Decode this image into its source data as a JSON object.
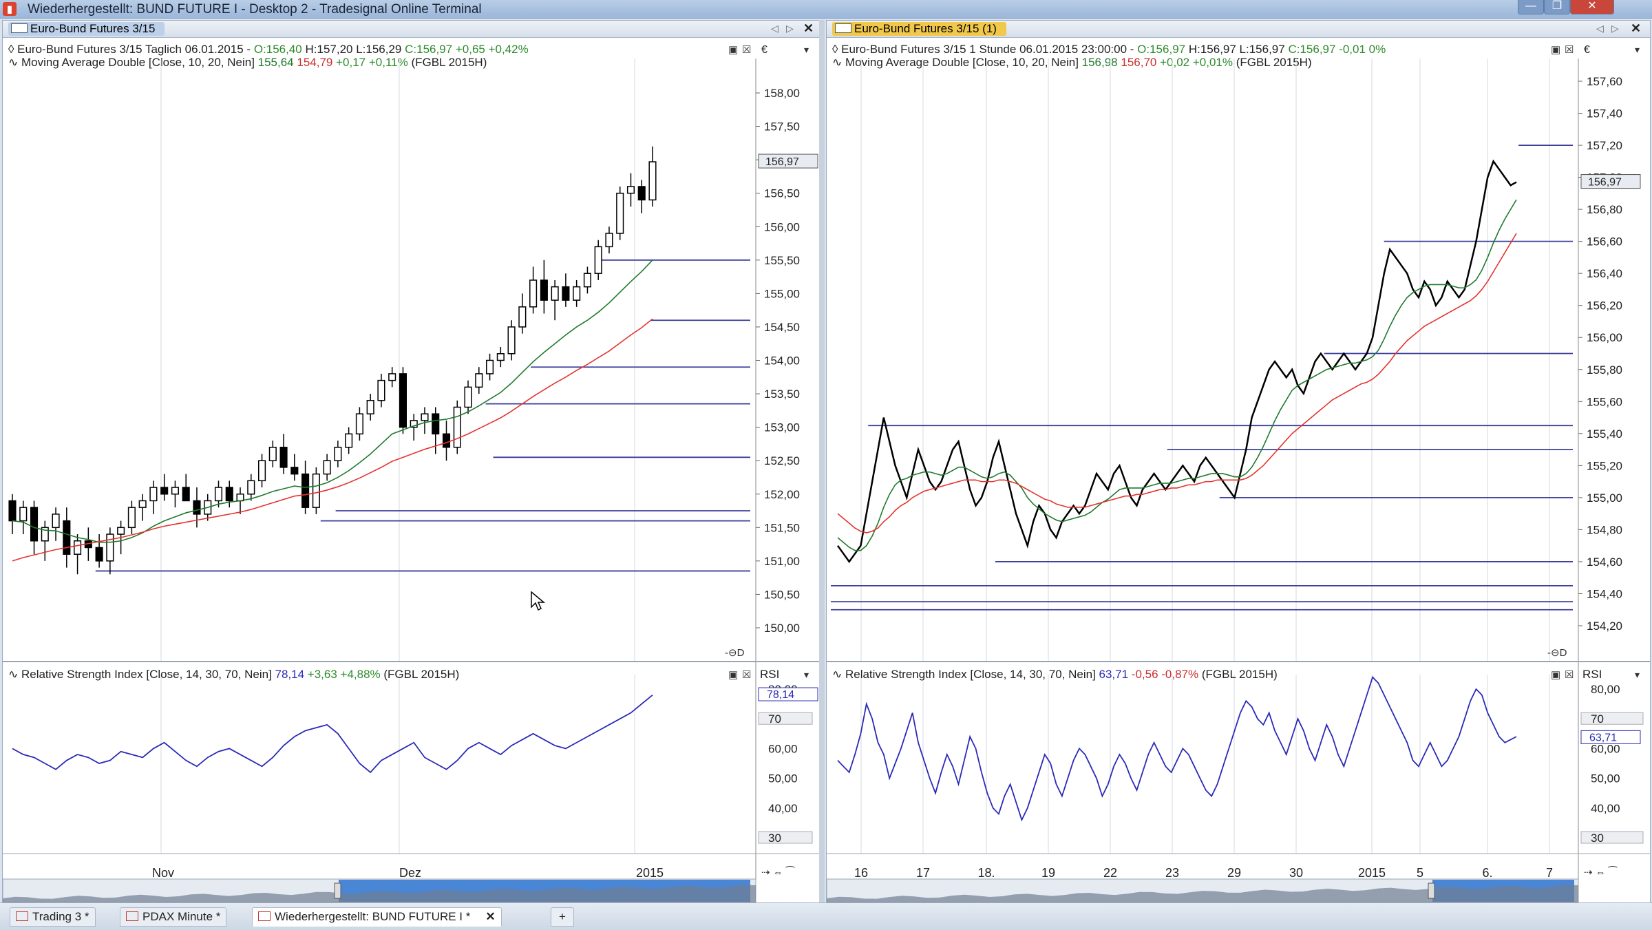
{
  "window": {
    "title": "Wiederhergestellt: BUND FUTURE I - Desktop 2 - Tradesignal Online Terminal",
    "minimize": "—",
    "maximize": "❐",
    "close": "✕"
  },
  "colors": {
    "accent": "#d9432f",
    "candle_up": "#ffffff",
    "candle_down": "#000000",
    "ma_short": "#1f7a2c",
    "ma_long": "#e3342f",
    "rsi": "#2a2ab8",
    "hline": "#3b3f9a",
    "price_tag": "#e8ecf2"
  },
  "left": {
    "tab_label": "Euro-Bund Futures 3/15",
    "header": {
      "line1_prefix": "Euro-Bund Futures 3/15 Taglich  06.01.2015 -",
      "line1_open": "O:156,40",
      "line1_hlc": "H:157,20 L:156,29",
      "line1_close": "C:156,97",
      "line1_change": "+0,65 +0,42%",
      "line2_prefix": "Moving Average Double [Close, 10, 20, Nein]",
      "line2_v1": "155,64",
      "line2_v2": "154,79",
      "line2_change": "+0,17 +0,11%",
      "line2_suffix": "(FGBL 2015H)"
    },
    "currency": "€",
    "price_tag": "156,97",
    "price_ticks": [
      "158,00",
      "157,50",
      "157,00",
      "156,50",
      "156,00",
      "155,50",
      "155,00",
      "154,50",
      "154,00",
      "153,50",
      "153,00",
      "152,50",
      "152,00",
      "151,50",
      "151,00",
      "150,50",
      "150,00"
    ],
    "rsi_header": {
      "prefix": "Relative Strength Index [Close, 14, 30, 70, Nein]",
      "value": "78,14",
      "change": "+3,63 +4,88%",
      "suffix": "(FGBL 2015H)"
    },
    "rsi_label": "RSI",
    "rsi_tag": "78,14",
    "rsi_ticks": [
      "80,00",
      "70",
      "60,00",
      "50,00",
      "40,00",
      "30"
    ],
    "x_labels": [
      "Nov",
      "Dez",
      "2015"
    ],
    "candles": [
      [
        151.9,
        152.0,
        151.4,
        151.6
      ],
      [
        151.6,
        151.9,
        151.4,
        151.8
      ],
      [
        151.8,
        151.9,
        151.1,
        151.3
      ],
      [
        151.3,
        151.6,
        151.0,
        151.5
      ],
      [
        151.5,
        151.8,
        151.3,
        151.7
      ],
      [
        151.6,
        151.8,
        150.9,
        151.1
      ],
      [
        151.1,
        151.4,
        150.8,
        151.3
      ],
      [
        151.3,
        151.5,
        151.0,
        151.2
      ],
      [
        151.2,
        151.4,
        150.9,
        151.0
      ],
      [
        151.0,
        151.5,
        150.8,
        151.4
      ],
      [
        151.4,
        151.6,
        151.1,
        151.5
      ],
      [
        151.5,
        151.9,
        151.4,
        151.8
      ],
      [
        151.8,
        152.0,
        151.6,
        151.9
      ],
      [
        151.9,
        152.2,
        151.7,
        152.1
      ],
      [
        152.1,
        152.3,
        151.9,
        152.0
      ],
      [
        152.0,
        152.2,
        151.8,
        152.1
      ],
      [
        152.1,
        152.3,
        151.9,
        151.9
      ],
      [
        151.9,
        152.1,
        151.5,
        151.7
      ],
      [
        151.7,
        152.0,
        151.6,
        151.9
      ],
      [
        151.9,
        152.2,
        151.8,
        152.1
      ],
      [
        152.1,
        152.2,
        151.8,
        151.9
      ],
      [
        151.9,
        152.1,
        151.7,
        152.0
      ],
      [
        152.0,
        152.3,
        151.9,
        152.2
      ],
      [
        152.2,
        152.6,
        152.1,
        152.5
      ],
      [
        152.5,
        152.8,
        152.4,
        152.7
      ],
      [
        152.7,
        152.9,
        152.3,
        152.4
      ],
      [
        152.4,
        152.6,
        152.2,
        152.3
      ],
      [
        152.3,
        152.5,
        151.7,
        151.8
      ],
      [
        151.8,
        152.4,
        151.7,
        152.3
      ],
      [
        152.3,
        152.6,
        152.2,
        152.5
      ],
      [
        152.5,
        152.8,
        152.4,
        152.7
      ],
      [
        152.7,
        153.0,
        152.6,
        152.9
      ],
      [
        152.9,
        153.3,
        152.8,
        153.2
      ],
      [
        153.2,
        153.5,
        153.1,
        153.4
      ],
      [
        153.4,
        153.8,
        153.3,
        153.7
      ],
      [
        153.7,
        153.9,
        153.6,
        153.8
      ],
      [
        153.8,
        153.9,
        152.9,
        153.0
      ],
      [
        153.0,
        153.2,
        152.8,
        153.1
      ],
      [
        153.1,
        153.3,
        152.9,
        153.2
      ],
      [
        153.2,
        153.3,
        152.6,
        152.9
      ],
      [
        152.9,
        153.1,
        152.5,
        152.7
      ],
      [
        152.7,
        153.4,
        152.6,
        153.3
      ],
      [
        153.3,
        153.7,
        153.2,
        153.6
      ],
      [
        153.6,
        153.9,
        153.5,
        153.8
      ],
      [
        153.8,
        154.1,
        153.7,
        154.0
      ],
      [
        154.0,
        154.2,
        153.9,
        154.1
      ],
      [
        154.1,
        154.6,
        154.0,
        154.5
      ],
      [
        154.5,
        155.0,
        154.4,
        154.8
      ],
      [
        154.8,
        155.4,
        154.7,
        155.2
      ],
      [
        155.2,
        155.5,
        154.7,
        154.9
      ],
      [
        154.9,
        155.2,
        154.6,
        155.1
      ],
      [
        155.1,
        155.3,
        154.8,
        154.9
      ],
      [
        154.9,
        155.2,
        154.8,
        155.1
      ],
      [
        155.1,
        155.4,
        155.0,
        155.3
      ],
      [
        155.3,
        155.8,
        155.2,
        155.7
      ],
      [
        155.7,
        156.0,
        155.6,
        155.9
      ],
      [
        155.9,
        156.6,
        155.8,
        156.5
      ],
      [
        156.5,
        156.8,
        156.3,
        156.6
      ],
      [
        156.6,
        156.7,
        156.2,
        156.4
      ],
      [
        156.4,
        157.2,
        156.3,
        156.97
      ]
    ],
    "ma10": [
      151.6,
      151.58,
      151.5,
      151.46,
      151.45,
      151.4,
      151.35,
      151.32,
      151.28,
      151.28,
      151.3,
      151.35,
      151.42,
      151.52,
      151.6,
      151.66,
      151.72,
      151.76,
      151.8,
      151.85,
      151.88,
      151.9,
      151.93,
      151.98,
      152.04,
      152.08,
      152.12,
      152.1,
      152.12,
      152.17,
      152.25,
      152.35,
      152.47,
      152.6,
      152.75,
      152.9,
      152.96,
      153.02,
      153.07,
      153.1,
      153.12,
      153.16,
      153.23,
      153.32,
      153.42,
      153.52,
      153.66,
      153.82,
      153.98,
      154.12,
      154.25,
      154.38,
      154.5,
      154.6,
      154.72,
      154.86,
      155.02,
      155.18,
      155.33,
      155.5
    ],
    "ma20": [
      151.0,
      151.05,
      151.09,
      151.13,
      151.17,
      151.2,
      151.23,
      151.26,
      151.29,
      151.32,
      151.35,
      151.39,
      151.43,
      151.48,
      151.52,
      151.55,
      151.58,
      151.61,
      151.64,
      151.67,
      151.7,
      151.73,
      151.77,
      151.82,
      151.87,
      151.92,
      151.97,
      151.99,
      152.02,
      152.06,
      152.11,
      152.17,
      152.24,
      152.32,
      152.4,
      152.49,
      152.55,
      152.61,
      152.67,
      152.72,
      152.77,
      152.83,
      152.9,
      152.98,
      153.06,
      153.14,
      153.24,
      153.35,
      153.46,
      153.56,
      153.66,
      153.75,
      153.85,
      153.94,
      154.04,
      154.14,
      154.26,
      154.38,
      154.49,
      154.62
    ],
    "hlines": [
      {
        "v": 155.5,
        "from": 0.79
      },
      {
        "v": 154.6,
        "from": 0.86
      },
      {
        "v": 153.9,
        "from": 0.7
      },
      {
        "v": 153.35,
        "from": 0.64
      },
      {
        "v": 152.55,
        "from": 0.65
      },
      {
        "v": 151.75,
        "from": 0.44
      },
      {
        "v": 151.6,
        "from": 0.42
      },
      {
        "v": 150.85,
        "from": 0.12
      }
    ],
    "rsi": [
      60,
      58,
      57,
      55,
      53,
      56,
      58,
      57,
      55,
      56,
      59,
      58,
      57,
      60,
      62,
      59,
      56,
      54,
      57,
      59,
      60,
      58,
      56,
      54,
      57,
      61,
      64,
      66,
      67,
      68,
      65,
      60,
      55,
      52,
      56,
      58,
      60,
      62,
      57,
      55,
      53,
      56,
      60,
      62,
      60,
      58,
      61,
      63,
      65,
      63,
      61,
      60,
      62,
      64,
      66,
      68,
      70,
      72,
      75,
      78
    ]
  },
  "right": {
    "tab_label": "Euro-Bund Futures 3/15 (1)",
    "header": {
      "line1_prefix": "Euro-Bund Futures 3/15 1 Stunde  06.01.2015 23:00:00 -",
      "line1_open": "O:156,97",
      "line1_hlc": "H:156,97 L:156,97",
      "line1_close": "C:156,97",
      "line1_change": "-0,01 0%",
      "line2_prefix": "Moving Average Double [Close, 10, 20, Nein]",
      "line2_v1": "156,98",
      "line2_v2": "156,70",
      "line2_change": "+0,02 +0,01%",
      "line2_suffix": "(FGBL 2015H)"
    },
    "currency": "€",
    "price_tag": "156,97",
    "price_ticks": [
      "157,60",
      "157,40",
      "157,20",
      "157,00",
      "156,80",
      "156,60",
      "156,40",
      "156,20",
      "156,00",
      "155,80",
      "155,60",
      "155,40",
      "155,20",
      "155,00",
      "154,80",
      "154,60",
      "154,40",
      "154,20"
    ],
    "rsi_header": {
      "prefix": "Relative Strength Index [Close, 14, 30, 70, Nein]",
      "value": "63,71",
      "change": "-0,56 -0,87%",
      "suffix": "(FGBL 2015H)"
    },
    "rsi_label": "RSI",
    "rsi_tag": "63,71",
    "rsi_ticks": [
      "80,00",
      "70",
      "60,00",
      "50,00",
      "40,00",
      "30"
    ],
    "x_labels": [
      "16",
      "17",
      "18.",
      "19",
      "22",
      "23",
      "29",
      "30",
      "2015",
      "5",
      "6.",
      "7"
    ],
    "hlines": [
      {
        "v": 157.2,
        "from": 0.92
      },
      {
        "v": 156.6,
        "from": 0.74
      },
      {
        "v": 155.9,
        "from": 0.66
      },
      {
        "v": 155.45,
        "from": 0.05
      },
      {
        "v": 155.3,
        "from": 0.45
      },
      {
        "v": 155.0,
        "from": 0.52
      },
      {
        "v": 154.6,
        "from": 0.22
      },
      {
        "v": 154.45,
        "from": 0
      },
      {
        "v": 154.35,
        "from": 0
      },
      {
        "v": 154.3,
        "from": 0
      }
    ],
    "closes": [
      154.7,
      154.65,
      154.6,
      154.65,
      154.7,
      154.9,
      155.1,
      155.3,
      155.5,
      155.35,
      155.2,
      155.1,
      155.0,
      155.15,
      155.3,
      155.2,
      155.1,
      155.05,
      155.1,
      155.2,
      155.3,
      155.35,
      155.2,
      155.05,
      154.95,
      155.0,
      155.1,
      155.25,
      155.35,
      155.2,
      155.05,
      154.9,
      154.8,
      154.7,
      154.85,
      154.95,
      154.9,
      154.8,
      154.75,
      154.85,
      154.9,
      154.95,
      154.9,
      154.95,
      155.05,
      155.15,
      155.1,
      155.05,
      155.15,
      155.2,
      155.1,
      155.0,
      154.95,
      155.05,
      155.1,
      155.15,
      155.1,
      155.05,
      155.1,
      155.15,
      155.2,
      155.15,
      155.1,
      155.2,
      155.25,
      155.2,
      155.15,
      155.1,
      155.05,
      155.0,
      155.15,
      155.3,
      155.5,
      155.6,
      155.7,
      155.8,
      155.85,
      155.8,
      155.75,
      155.8,
      155.7,
      155.65,
      155.75,
      155.85,
      155.9,
      155.85,
      155.8,
      155.85,
      155.9,
      155.85,
      155.8,
      155.85,
      155.9,
      156.0,
      156.2,
      156.4,
      156.55,
      156.5,
      156.45,
      156.4,
      156.3,
      156.25,
      156.35,
      156.3,
      156.2,
      156.25,
      156.35,
      156.3,
      156.25,
      156.3,
      156.45,
      156.6,
      156.8,
      157.0,
      157.1,
      157.05,
      157.0,
      156.95,
      156.97
    ],
    "ma10": [
      154.75,
      154.72,
      154.69,
      154.67,
      154.67,
      154.7,
      154.76,
      154.84,
      154.94,
      155.02,
      155.08,
      155.11,
      155.12,
      155.14,
      155.15,
      155.16,
      155.16,
      155.15,
      155.14,
      155.15,
      155.17,
      155.19,
      155.19,
      155.17,
      155.15,
      155.13,
      155.12,
      155.13,
      155.15,
      155.16,
      155.14,
      155.1,
      155.06,
      155.0,
      154.96,
      154.93,
      154.9,
      154.88,
      154.86,
      154.85,
      154.86,
      154.87,
      154.88,
      154.89,
      154.91,
      154.94,
      154.97,
      154.99,
      155.02,
      155.05,
      155.06,
      155.06,
      155.06,
      155.06,
      155.07,
      155.08,
      155.09,
      155.09,
      155.09,
      155.1,
      155.11,
      155.12,
      155.12,
      155.13,
      155.14,
      155.15,
      155.15,
      155.15,
      155.14,
      155.13,
      155.13,
      155.15,
      155.19,
      155.25,
      155.32,
      155.4,
      155.48,
      155.55,
      155.61,
      155.67,
      155.7,
      155.72,
      155.74,
      155.76,
      155.78,
      155.8,
      155.81,
      155.82,
      155.83,
      155.84,
      155.84,
      155.85,
      155.86,
      155.88,
      155.92,
      155.99,
      156.07,
      156.14,
      156.2,
      156.25,
      156.28,
      156.3,
      156.32,
      156.33,
      156.33,
      156.33,
      156.33,
      156.32,
      156.31,
      156.31,
      156.33,
      156.36,
      156.42,
      156.5,
      156.59,
      156.67,
      156.74,
      156.8,
      156.86
    ],
    "ma20": [
      154.9,
      154.87,
      154.84,
      154.81,
      154.79,
      154.78,
      154.79,
      154.81,
      154.85,
      154.88,
      154.92,
      154.95,
      154.97,
      155.0,
      155.02,
      155.04,
      155.05,
      155.06,
      155.07,
      155.08,
      155.09,
      155.1,
      155.11,
      155.11,
      155.11,
      155.1,
      155.1,
      155.1,
      155.11,
      155.11,
      155.1,
      155.09,
      155.07,
      155.05,
      155.03,
      155.01,
      154.99,
      154.98,
      154.96,
      154.95,
      154.94,
      154.94,
      154.94,
      154.94,
      154.95,
      154.96,
      154.97,
      154.98,
      154.99,
      155.0,
      155.01,
      155.01,
      155.02,
      155.02,
      155.03,
      155.04,
      155.05,
      155.05,
      155.06,
      155.06,
      155.07,
      155.08,
      155.08,
      155.09,
      155.1,
      155.1,
      155.11,
      155.11,
      155.11,
      155.11,
      155.11,
      155.12,
      155.14,
      155.17,
      155.2,
      155.24,
      155.28,
      155.32,
      155.36,
      155.4,
      155.43,
      155.46,
      155.49,
      155.52,
      155.55,
      155.58,
      155.61,
      155.63,
      155.65,
      155.67,
      155.69,
      155.71,
      155.72,
      155.74,
      155.77,
      155.81,
      155.85,
      155.9,
      155.94,
      155.98,
      156.01,
      156.04,
      156.07,
      156.09,
      156.11,
      156.13,
      156.15,
      156.17,
      156.19,
      156.21,
      156.23,
      156.26,
      156.3,
      156.35,
      156.41,
      156.47,
      156.53,
      156.59,
      156.65
    ],
    "rsi": [
      56,
      54,
      52,
      58,
      65,
      75,
      70,
      62,
      58,
      50,
      55,
      60,
      66,
      72,
      62,
      56,
      50,
      45,
      52,
      58,
      54,
      48,
      56,
      64,
      60,
      52,
      45,
      40,
      38,
      44,
      48,
      42,
      36,
      40,
      46,
      52,
      58,
      55,
      48,
      44,
      50,
      56,
      60,
      58,
      54,
      50,
      44,
      48,
      54,
      58,
      55,
      50,
      46,
      52,
      58,
      62,
      58,
      54,
      52,
      56,
      60,
      58,
      54,
      50,
      46,
      44,
      48,
      54,
      60,
      66,
      72,
      76,
      74,
      70,
      68,
      72,
      66,
      62,
      58,
      64,
      70,
      66,
      60,
      56,
      62,
      68,
      64,
      58,
      54,
      60,
      66,
      72,
      78,
      84,
      82,
      78,
      74,
      70,
      66,
      62,
      56,
      54,
      58,
      62,
      58,
      54,
      56,
      60,
      64,
      70,
      76,
      80,
      78,
      72,
      68,
      64,
      62,
      63,
      64
    ],
    "cursor": "⊖D"
  },
  "taskbar": {
    "tabs": [
      "Trading 3 *",
      "PDAX Minute *",
      "Wiederhergestellt: BUND FUTURE I *"
    ],
    "close_label": "✕",
    "add_label": "+"
  }
}
